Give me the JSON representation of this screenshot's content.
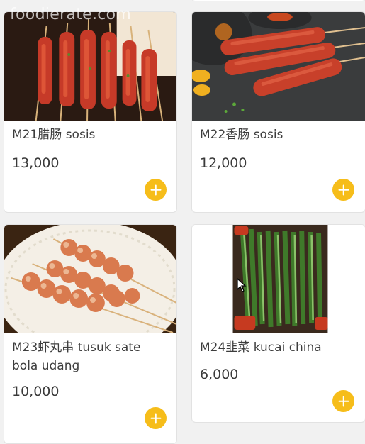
{
  "watermark": "foodierate.com",
  "items": [
    {
      "code_name": "M21腊肠 sosis",
      "price": "13,000",
      "image": "grilled-sausage-skewers-image"
    },
    {
      "code_name": "M22香肠 sosis",
      "price": "12,000",
      "image": "sausage-sticks-on-slate-image"
    },
    {
      "code_name": "M23虾丸串 tusuk sate bola udang",
      "price": "10,000",
      "image": "shrimp-ball-skewers-image"
    },
    {
      "code_name": "M24韭菜 kucai china",
      "price": "6,000",
      "image": "chinese-chive-skewers-image"
    }
  ],
  "colors": {
    "add_button": "#f6bd1a",
    "card": "#ffffff",
    "background": "#f1f1f1"
  },
  "icons": {
    "add": "plus-circle-icon",
    "cursor": "mouse-pointer-icon"
  }
}
